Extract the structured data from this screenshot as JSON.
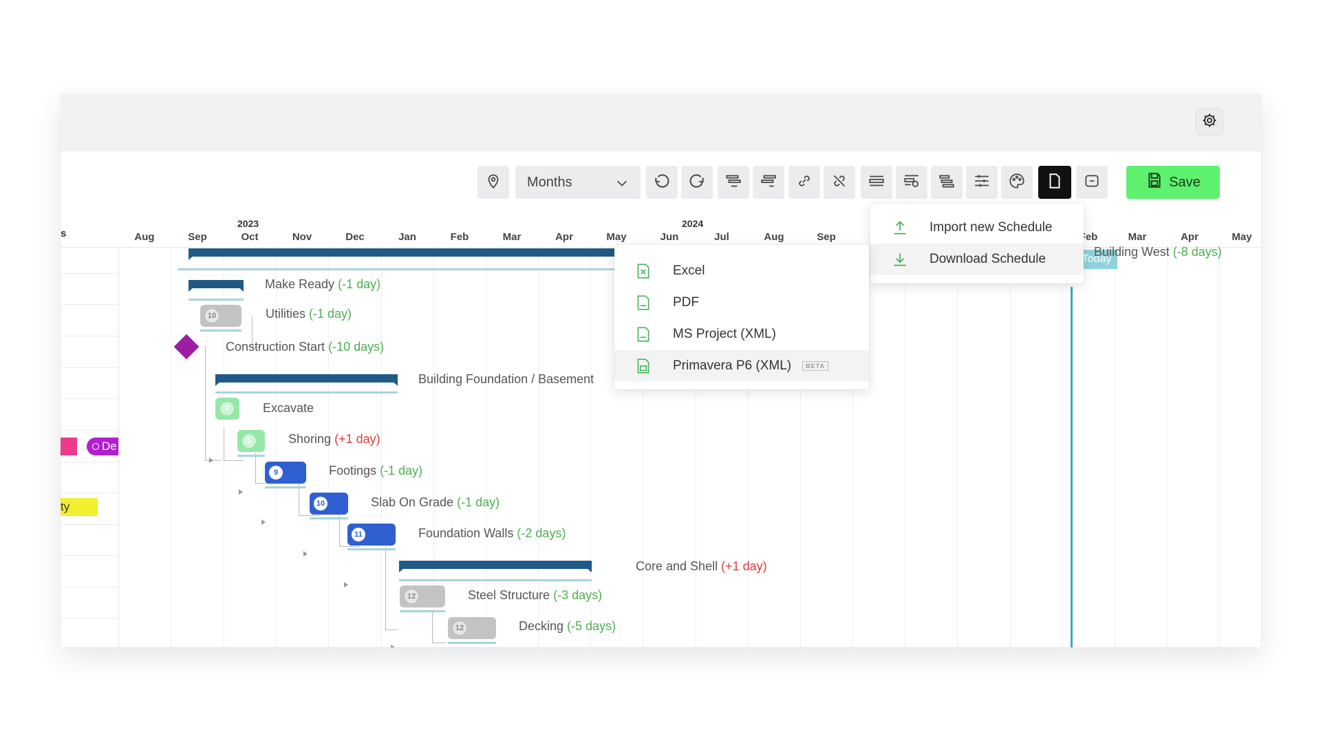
{
  "toolbar": {
    "zoom_select": "Months",
    "save_label": "Save"
  },
  "timeline": {
    "left_header": "s",
    "years": [
      "2023",
      "2024"
    ],
    "months": [
      "Aug",
      "Sep",
      "Oct",
      "Nov",
      "Dec",
      "Jan",
      "Feb",
      "Mar",
      "Apr",
      "May",
      "Jun",
      "Jul",
      "Aug",
      "Sep",
      "Feb",
      "Mar",
      "Apr",
      "May"
    ],
    "today_label": "Today",
    "left_chips": {
      "purple": "De",
      "yellow": "ty"
    }
  },
  "tasks": [
    {
      "name": "Make Ready",
      "delta": "(-1 day)"
    },
    {
      "name": "Utilities",
      "delta": "(-1 day)",
      "duration": "10"
    },
    {
      "name": "Construction Start",
      "delta": "(-10 days)"
    },
    {
      "name": "Building Foundation / Basement",
      "delta": ""
    },
    {
      "name": "Excavate",
      "delta": "",
      "duration": "7"
    },
    {
      "name": "Shoring",
      "delta": "(+1 day)",
      "duration": "5"
    },
    {
      "name": "Footings",
      "delta": "(-1 day)",
      "duration": "9"
    },
    {
      "name": "Slab On Grade",
      "delta": "(-1 day)",
      "duration": "10"
    },
    {
      "name": "Foundation Walls",
      "delta": "(-2 days)",
      "duration": "11"
    },
    {
      "name": "Core and Shell",
      "delta": "(+1 day)"
    },
    {
      "name": "Steel Structure",
      "delta": "(-3 days)",
      "duration": "12"
    },
    {
      "name": "Decking",
      "delta": "(-5 days)",
      "duration": "12"
    },
    {
      "name": "Building West",
      "delta": "(-8 days)"
    }
  ],
  "schedule_menu": {
    "items": [
      "Import new Schedule",
      "Download Schedule"
    ]
  },
  "download_menu": {
    "items": [
      "Excel",
      "PDF",
      "MS Project (XML)",
      "Primavera P6 (XML)"
    ],
    "beta_label": "BETA"
  },
  "colors": {
    "summary_bar": "#1f5a86",
    "save_button": "#5ef06f",
    "milestone": "#9b1ea5",
    "today_line": "#3da6b8",
    "delta_positive": "#e03a3a",
    "delta_negative": "#4caf50"
  },
  "icons": [
    "gear-icon",
    "pin-icon",
    "chevron-down-icon",
    "undo-icon",
    "redo-icon",
    "indent-icon",
    "outdent-icon",
    "link-icon",
    "unlink-icon",
    "collapse-icon",
    "filter-icon",
    "sort-icon",
    "sliders-icon",
    "palette-icon",
    "document-icon",
    "baseline-icon",
    "save-icon",
    "upload-icon",
    "download-icon",
    "excel-file-icon",
    "pdf-file-icon",
    "xml-file-icon",
    "p6-file-icon"
  ]
}
